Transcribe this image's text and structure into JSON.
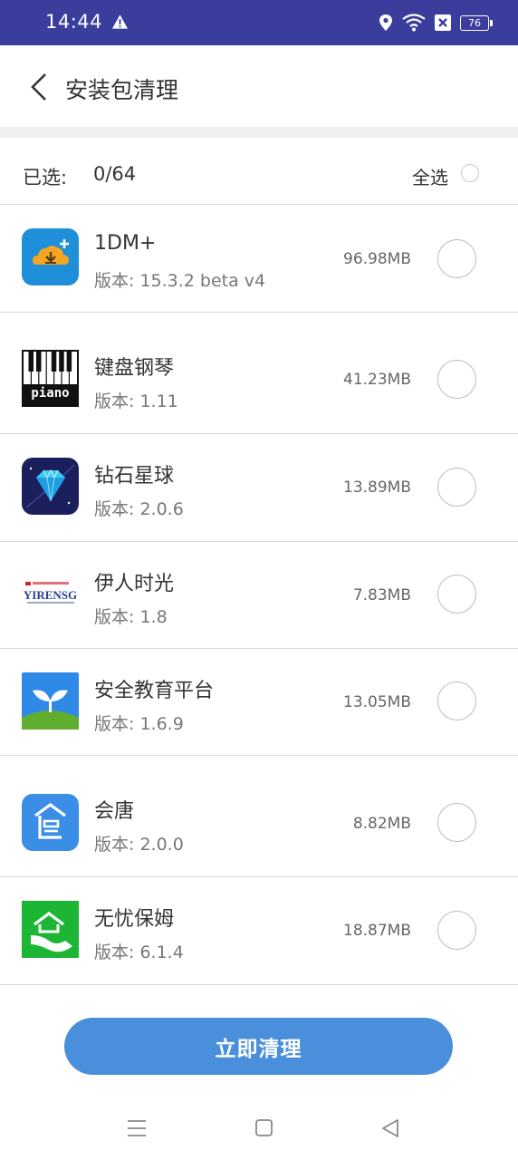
{
  "status_bar": {
    "time": "14:44",
    "battery": "76",
    "icons": [
      "warning-icon",
      "location-icon",
      "wifi-icon",
      "sim-blocked-icon",
      "battery-icon"
    ]
  },
  "header": {
    "title": "安装包清理",
    "back_icon": "chevron-left-icon"
  },
  "selection": {
    "label": "已选:",
    "count": "0/64",
    "select_all": "全选"
  },
  "apps": [
    {
      "name": "1DM+",
      "version": "版本: 15.3.2 beta v4",
      "size": "96.98MB",
      "icon": "1dm-download-icon"
    },
    {
      "name": "键盘钢琴",
      "version": "版本: 1.11",
      "size": "41.23MB",
      "icon": "piano-icon",
      "icon_text": "piano"
    },
    {
      "name": "钻石星球",
      "version": "版本: 2.0.6",
      "size": "13.89MB",
      "icon": "diamond-icon"
    },
    {
      "name": "伊人时光",
      "version": "版本: 1.8",
      "size": "7.83MB",
      "icon": "yirensg-logo",
      "icon_text": "YIRENSG"
    },
    {
      "name": "安全教育平台",
      "version": "版本: 1.6.9",
      "size": "13.05MB",
      "icon": "sprout-icon"
    },
    {
      "name": "会唐",
      "version": "版本: 2.0.0",
      "size": "8.82MB",
      "icon": "huitang-icon"
    },
    {
      "name": "无忧保姆",
      "version": "版本: 6.1.4",
      "size": "18.87MB",
      "icon": "nanny-house-icon"
    }
  ],
  "clean_button": {
    "label": "立即清理"
  },
  "colors": {
    "status_bar": "#3a3d9c",
    "accent": "#4a8fdc",
    "divider": "#d8d8d8"
  },
  "nav": [
    "menu-icon",
    "home-icon",
    "back-icon"
  ]
}
